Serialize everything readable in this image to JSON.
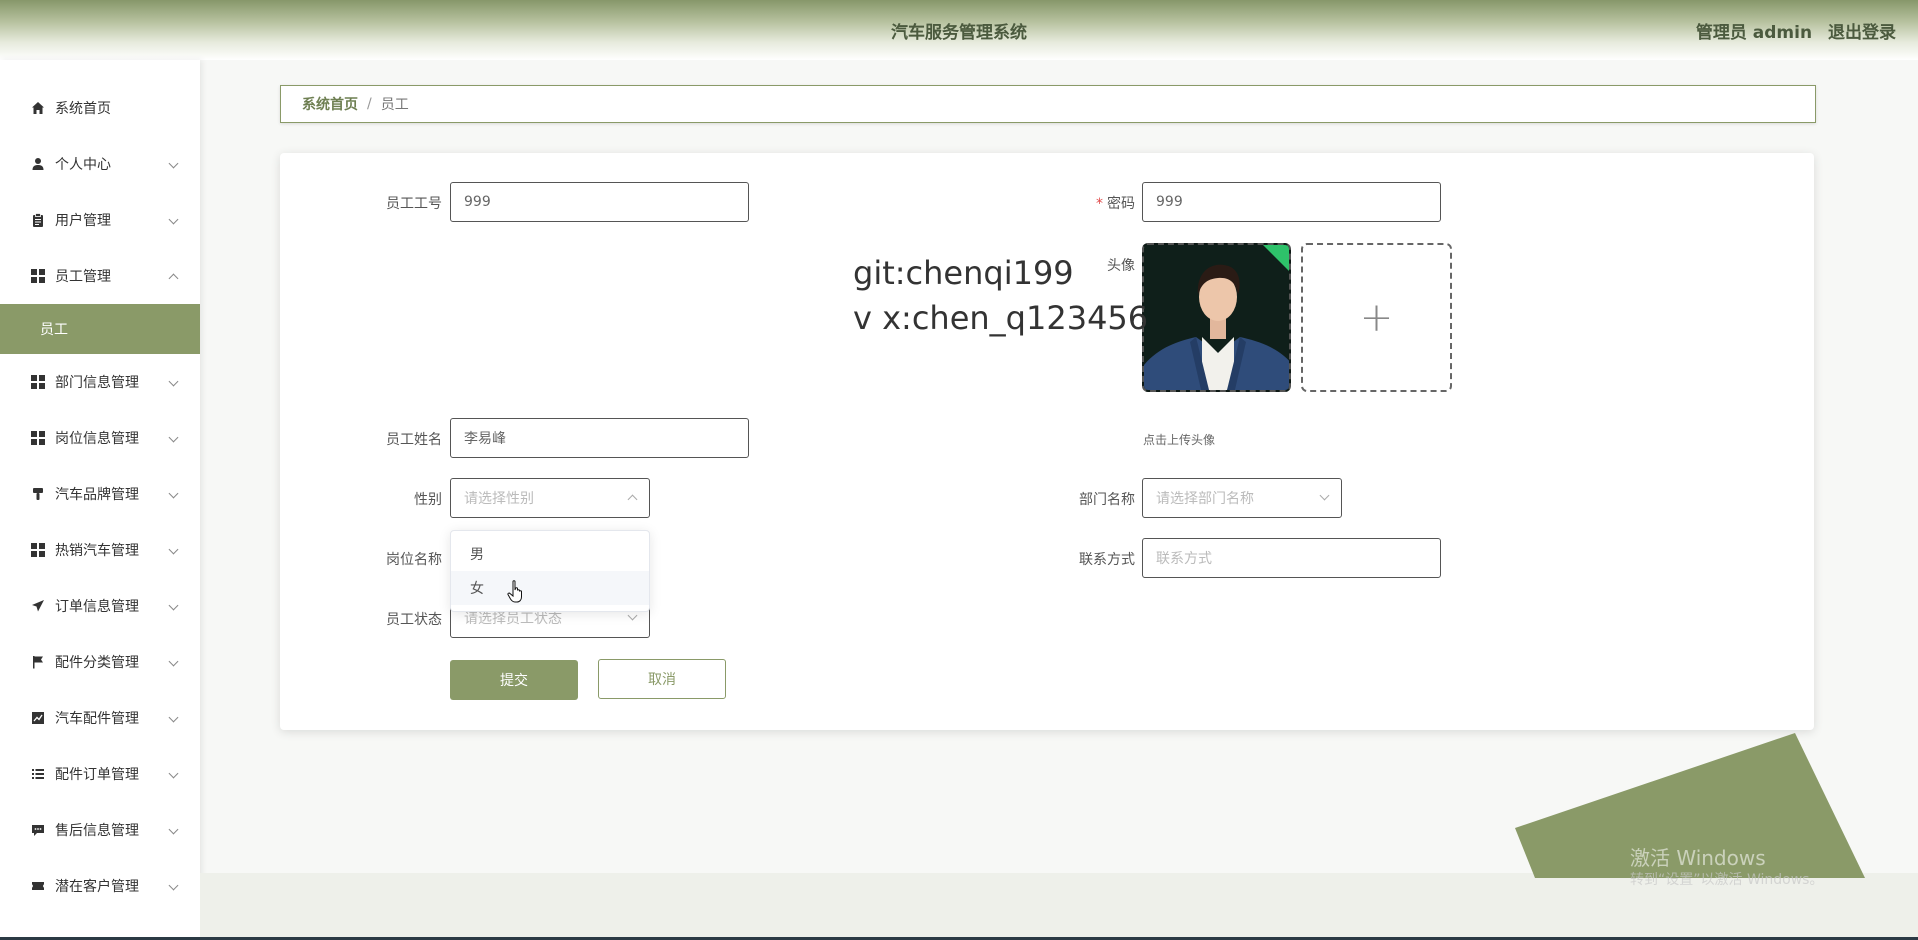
{
  "header": {
    "title": "汽车服务管理系统",
    "user_label": "管理员 admin",
    "logout_label": "退出登录"
  },
  "sidebar": {
    "items": [
      {
        "label": "系统首页",
        "icon": "home-icon"
      },
      {
        "label": "个人中心",
        "icon": "user-icon"
      },
      {
        "label": "用户管理",
        "icon": "clipboard-icon"
      },
      {
        "label": "员工管理",
        "icon": "grid-icon"
      },
      {
        "label": "部门信息管理",
        "icon": "grid-icon"
      },
      {
        "label": "岗位信息管理",
        "icon": "grid-icon"
      },
      {
        "label": "汽车品牌管理",
        "icon": "brush-icon"
      },
      {
        "label": "热销汽车管理",
        "icon": "grid-icon"
      },
      {
        "label": "订单信息管理",
        "icon": "send-icon"
      },
      {
        "label": "配件分类管理",
        "icon": "flag-icon"
      },
      {
        "label": "汽车配件管理",
        "icon": "chart-icon"
      },
      {
        "label": "配件订单管理",
        "icon": "list-icon"
      },
      {
        "label": "售后信息管理",
        "icon": "message-icon"
      },
      {
        "label": "潜在客户管理",
        "icon": "ticket-icon"
      }
    ],
    "active_sub": "员工"
  },
  "breadcrumb": {
    "home": "系统首页",
    "separator": "/",
    "current": "员工"
  },
  "form": {
    "employee_no": {
      "label": "员工工号",
      "value": "999"
    },
    "password": {
      "label": "密码",
      "required_mark": "*",
      "value": "999"
    },
    "avatar": {
      "label": "头像",
      "hint": "点击上传头像",
      "add_symbol": "+"
    },
    "name": {
      "label": "员工姓名",
      "value": "李易峰"
    },
    "gender": {
      "label": "性别",
      "placeholder": "请选择性别",
      "options": [
        "男",
        "女"
      ],
      "hovered": "女"
    },
    "department": {
      "label": "部门名称",
      "placeholder": "请选择部门名称"
    },
    "position": {
      "label": "岗位名称"
    },
    "contact": {
      "label": "联系方式",
      "placeholder": "联系方式"
    },
    "status": {
      "label": "员工状态",
      "placeholder": "请选择员工状态"
    },
    "submit_label": "提交",
    "cancel_label": "取消"
  },
  "watermark": {
    "line1": "git:chenqi199",
    "line2": "v x:chen_q123456"
  },
  "os_notice": {
    "line1": "激活 Windows",
    "line2": "转到“设置”以激活 Windows。"
  },
  "colors": {
    "accent": "#8a9a68",
    "header_text": "#4b5a3e",
    "required": "#e04848",
    "upload_success": "#2ec26a"
  }
}
